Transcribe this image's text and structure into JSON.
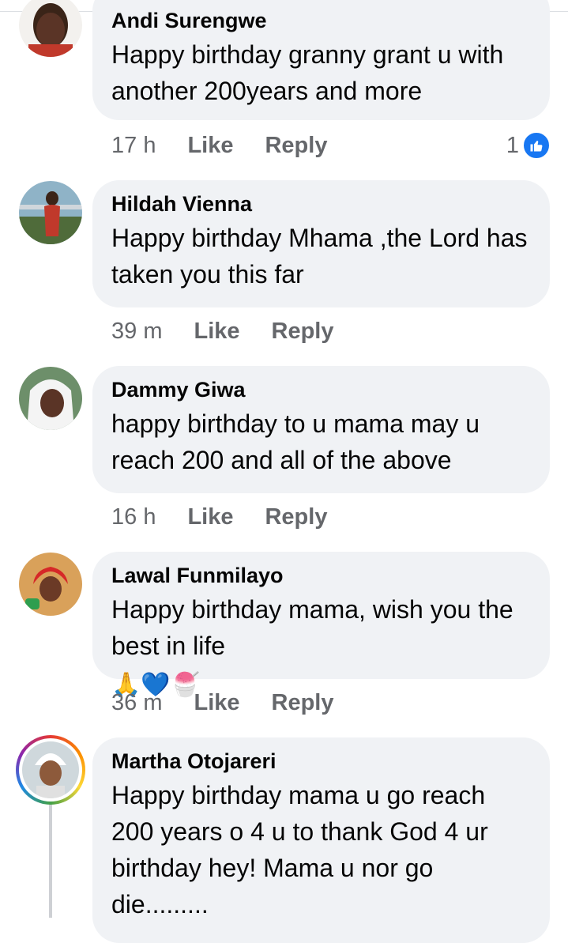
{
  "comments": [
    {
      "author": "Andi Surengwe",
      "text": "Happy birthday granny grant u with another 200years and more",
      "time": "17 h",
      "like_label": "Like",
      "reply_label": "Reply",
      "reaction_count": "1"
    },
    {
      "author": "Hildah Vienna",
      "text": "Happy birthday Mhama ,the Lord has taken you this far",
      "time": "39 m",
      "like_label": "Like",
      "reply_label": "Reply"
    },
    {
      "author": "Dammy Giwa",
      "text": "happy birthday to u mama may u reach 200 and all of the above",
      "time": "16 h",
      "like_label": "Like",
      "reply_label": "Reply"
    },
    {
      "author": "Lawal Funmilayo",
      "text": "Happy birthday mama, wish  you the best in life",
      "emoji": [
        "🙏",
        "💙",
        "🍧"
      ],
      "time": "36 m",
      "like_label": "Like",
      "reply_label": "Reply"
    },
    {
      "author": "Martha Otojareri",
      "text": "Happy birthday mama u go reach 200 years o 4 u to thank God 4 ur birthday hey! Mama u nor go die........."
    }
  ],
  "colors": {
    "bubble": "#f0f2f5",
    "meta_text": "#65676b",
    "like_blue": "#1877f2"
  },
  "icons": {
    "reaction": "thumbs-up-icon"
  }
}
